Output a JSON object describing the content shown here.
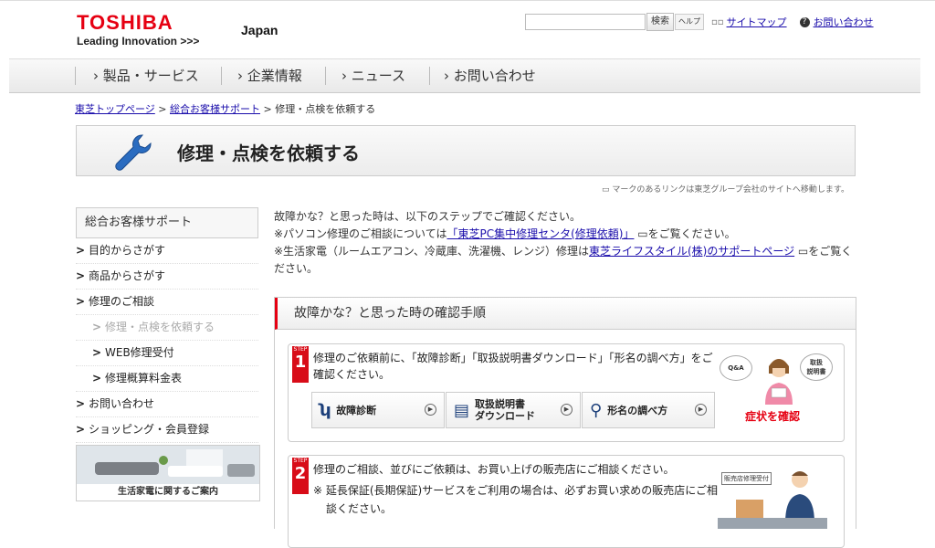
{
  "header": {
    "brand": "TOSHIBA",
    "tagline": "Leading Innovation >>>",
    "country": "Japan",
    "search": {
      "value": "",
      "button": "検索",
      "help": "ヘルプ"
    },
    "links": {
      "sitemap": "サイトマップ",
      "contact": "お問い合わせ"
    }
  },
  "nav": {
    "items": [
      "製品・サービス",
      "企業情報",
      "ニュース",
      "お問い合わせ"
    ]
  },
  "breadcrumb": {
    "items": [
      "東芝トップページ",
      "総合お客様サポート"
    ],
    "current": "修理・点検を依頼する",
    "sep": ">"
  },
  "page": {
    "title": "修理・点検を依頼する",
    "note": "マークのあるリンクは東芝グループ会社のサイトへ移動します。"
  },
  "sidebar": {
    "heading": "総合お客様サポート",
    "items": [
      {
        "label": "目的からさがす"
      },
      {
        "label": "商品からさがす"
      },
      {
        "label": "修理のご相談"
      },
      {
        "label": "修理・点検を依頼する"
      },
      {
        "label": "WEB修理受付"
      },
      {
        "label": "修理概算料金表"
      },
      {
        "label": "お問い合わせ"
      },
      {
        "label": "ショッピング・会員登録"
      }
    ],
    "banner": "生活家電に関するご案内"
  },
  "intro": {
    "line1": "故障かな？と思った時は、以下のステップでご確認ください。",
    "line2_pre": "※パソコン修理のご相談については",
    "line2_link": "「東芝PC集中修理センタ(修理依頼)」",
    "line2_post": "をご覧ください。",
    "line3_pre": "※生活家電（ルームエアコン、冷蔵庫、洗濯機、レンジ）修理は",
    "line3_link": "東芝ライフスタイル(株)のサポートページ",
    "line3_post": "をご覧ください。"
  },
  "steps": {
    "heading": "故障かな？と思った時の確認手順",
    "step_label": "STEP",
    "step1": {
      "num": "1",
      "text": "修理のご依頼前に、「故障診断」「取扱説明書ダウンロード」「形名の調べ方」をご確認ください。",
      "buttons": [
        "故障診断",
        "取扱説明書\nダウンロード",
        "形名の調べ方"
      ],
      "illus": {
        "qa": "Q&A",
        "manual": "取扱\n説明書",
        "caption": "症状を確認"
      }
    },
    "step2": {
      "num": "2",
      "text": "修理のご相談、並びにご依頼は、お買い上げの販売店にご相談ください。",
      "note": "※ 延長保証(長期保証)サービスをご利用の場合は、必ずお買い求めの販売店にご相談ください。",
      "illus": {
        "sign": "販売店修理受付"
      }
    }
  }
}
